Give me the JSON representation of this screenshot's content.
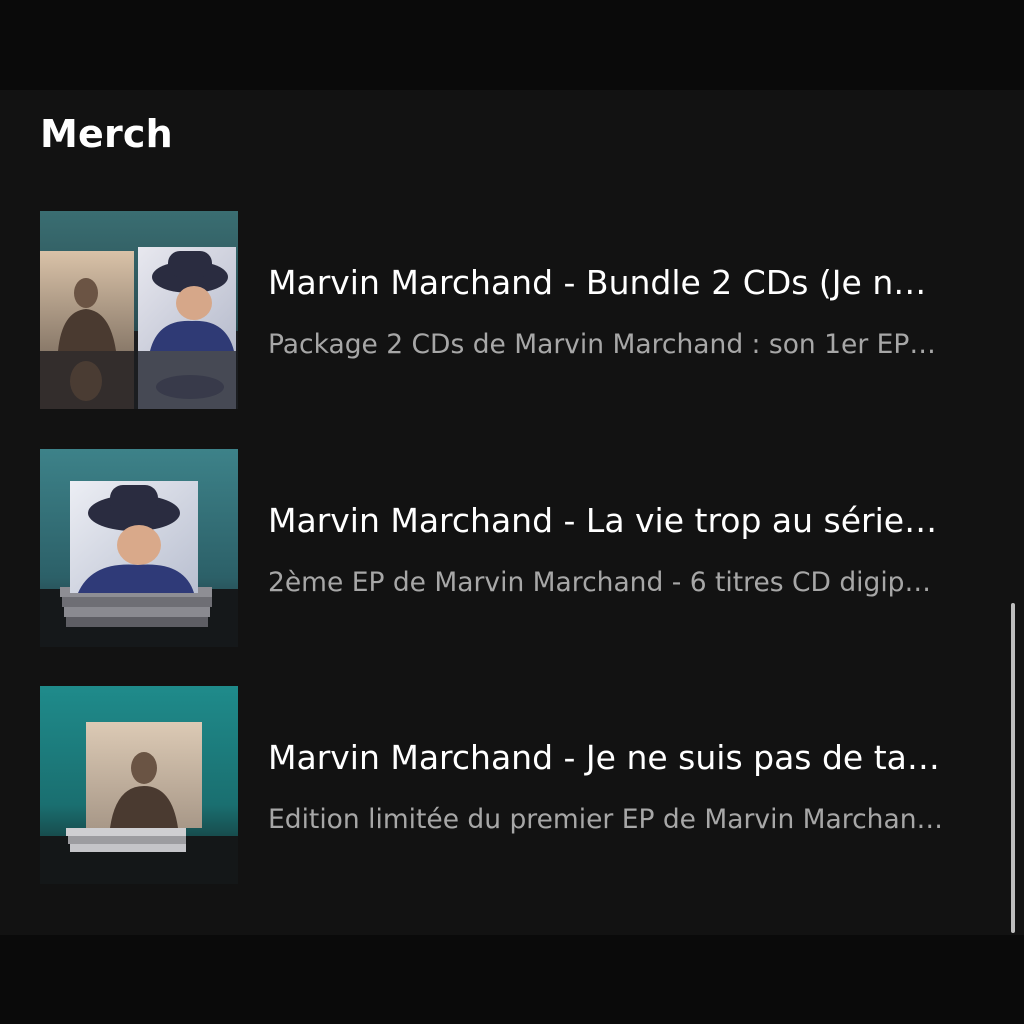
{
  "merch": {
    "title": "Merch",
    "items": [
      {
        "title": "Marvin Marchand - Bundle 2 CDs (Je n…",
        "subtitle": "Package 2 CDs de Marvin Marchand : son 1er EP…",
        "image": "bundle-2-cds-photo"
      },
      {
        "title": "Marvin Marchand - La vie trop au série…",
        "subtitle": "2ème EP de Marvin Marchand - 6 titres CD digip…",
        "image": "la-vie-trop-au-serieux-cd-photo"
      },
      {
        "title": "Marvin Marchand - Je ne suis pas de ta…",
        "subtitle": "Edition limitée du premier EP de Marvin Marchan…",
        "image": "je-ne-suis-pas-cd-photo"
      }
    ]
  },
  "colors": {
    "background": "#121212",
    "outer_background": "#0a0a0a",
    "title_text": "#ffffff",
    "subtitle_text": "#a7a7a7",
    "scrollbar": "#bdbdbd"
  }
}
